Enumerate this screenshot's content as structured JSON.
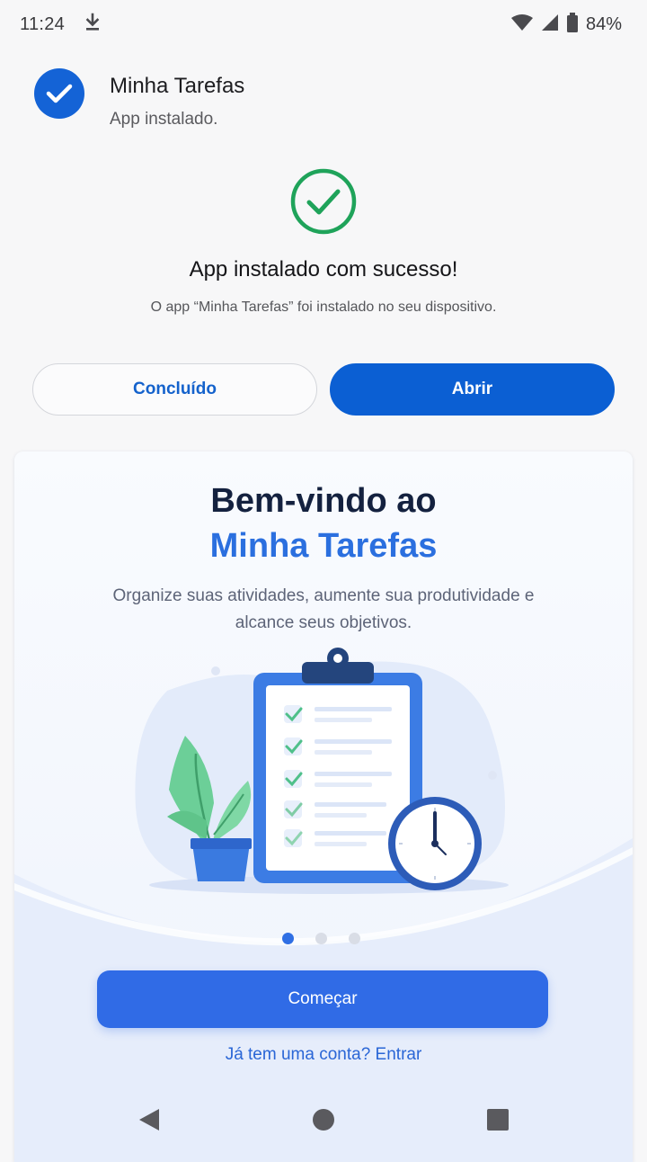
{
  "status_bar": {
    "time": "11:24",
    "battery": "84%",
    "icons": [
      "download-icon",
      "wifi-icon",
      "signal-icon",
      "battery-icon"
    ]
  },
  "notification": {
    "app_name": "Minha Tarefas",
    "subtitle": "App instalado."
  },
  "success": {
    "title": "App instalado com sucesso!",
    "subtitle": "O app “Minha Tarefas” foi instalado no seu dispositivo."
  },
  "actions": {
    "done_label": "Concluído",
    "open_label": "Abrir"
  },
  "welcome": {
    "line1": "Bem-vindo ao",
    "line2": "Minha Tarefas",
    "description": "Organize suas atividades, aumente sua produtividade e alcance seus objetivos.",
    "pager": {
      "total": 3,
      "active": 1
    },
    "start_label": "Começar",
    "login_label": "Já tem uma conta? Entrar"
  },
  "colors": {
    "primary": "#0b5fd3",
    "accent_blue": "#2b6fdf",
    "success_green": "#1fa35a",
    "heading_dark": "#14213f"
  },
  "nav": [
    "back-icon",
    "home-icon",
    "recents-icon"
  ]
}
